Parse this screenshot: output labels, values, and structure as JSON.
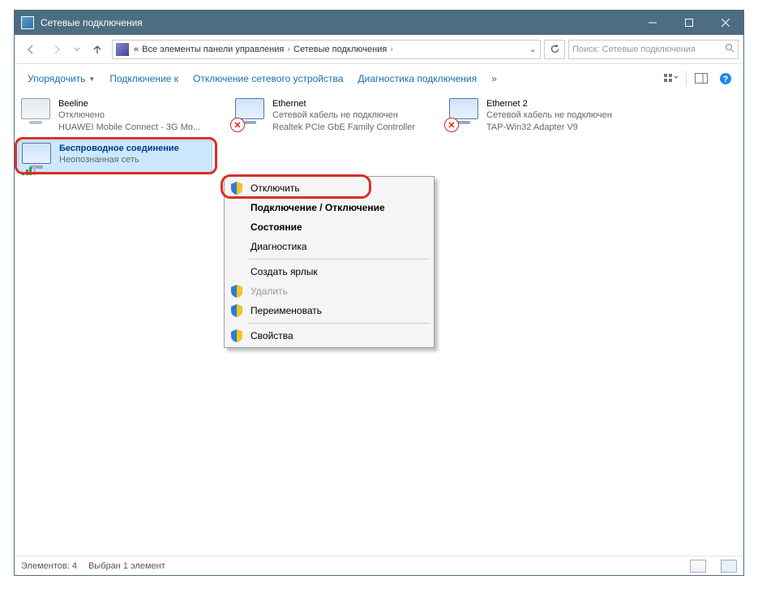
{
  "window": {
    "title": "Сетевые подключения"
  },
  "address": {
    "prefix": "«",
    "crumb1": "Все элементы панели управления",
    "crumb2": "Сетевые подключения"
  },
  "search": {
    "placeholder": "Поиск: Сетевые подключения"
  },
  "toolbar": {
    "organize": "Упорядочить",
    "connect": "Подключение к",
    "disable": "Отключение сетевого устройства",
    "diagnose": "Диагностика подключения",
    "more": "»"
  },
  "connections": {
    "beeline": {
      "name": "Beeline",
      "status": "Отключено",
      "device": "HUAWEI Mobile Connect - 3G Mo..."
    },
    "ethernet": {
      "name": "Ethernet",
      "status": "Сетевой кабель не подключен",
      "device": "Realtek PCIe GbE Family Controller"
    },
    "ethernet2": {
      "name": "Ethernet 2",
      "status": "Сетевой кабель не подключен",
      "device": "TAP-Win32 Adapter V9"
    },
    "wireless": {
      "name": "Беспроводное соединение",
      "status": "Неопознанная сеть"
    }
  },
  "context_menu": {
    "disable": "Отключить",
    "connect_disconnect": "Подключение / Отключение",
    "state": "Состояние",
    "diagnostics": "Диагностика",
    "shortcut": "Создать ярлык",
    "delete": "Удалить",
    "rename": "Переименовать",
    "properties": "Свойства"
  },
  "statusbar": {
    "count": "Элементов: 4",
    "selected": "Выбран 1 элемент"
  }
}
